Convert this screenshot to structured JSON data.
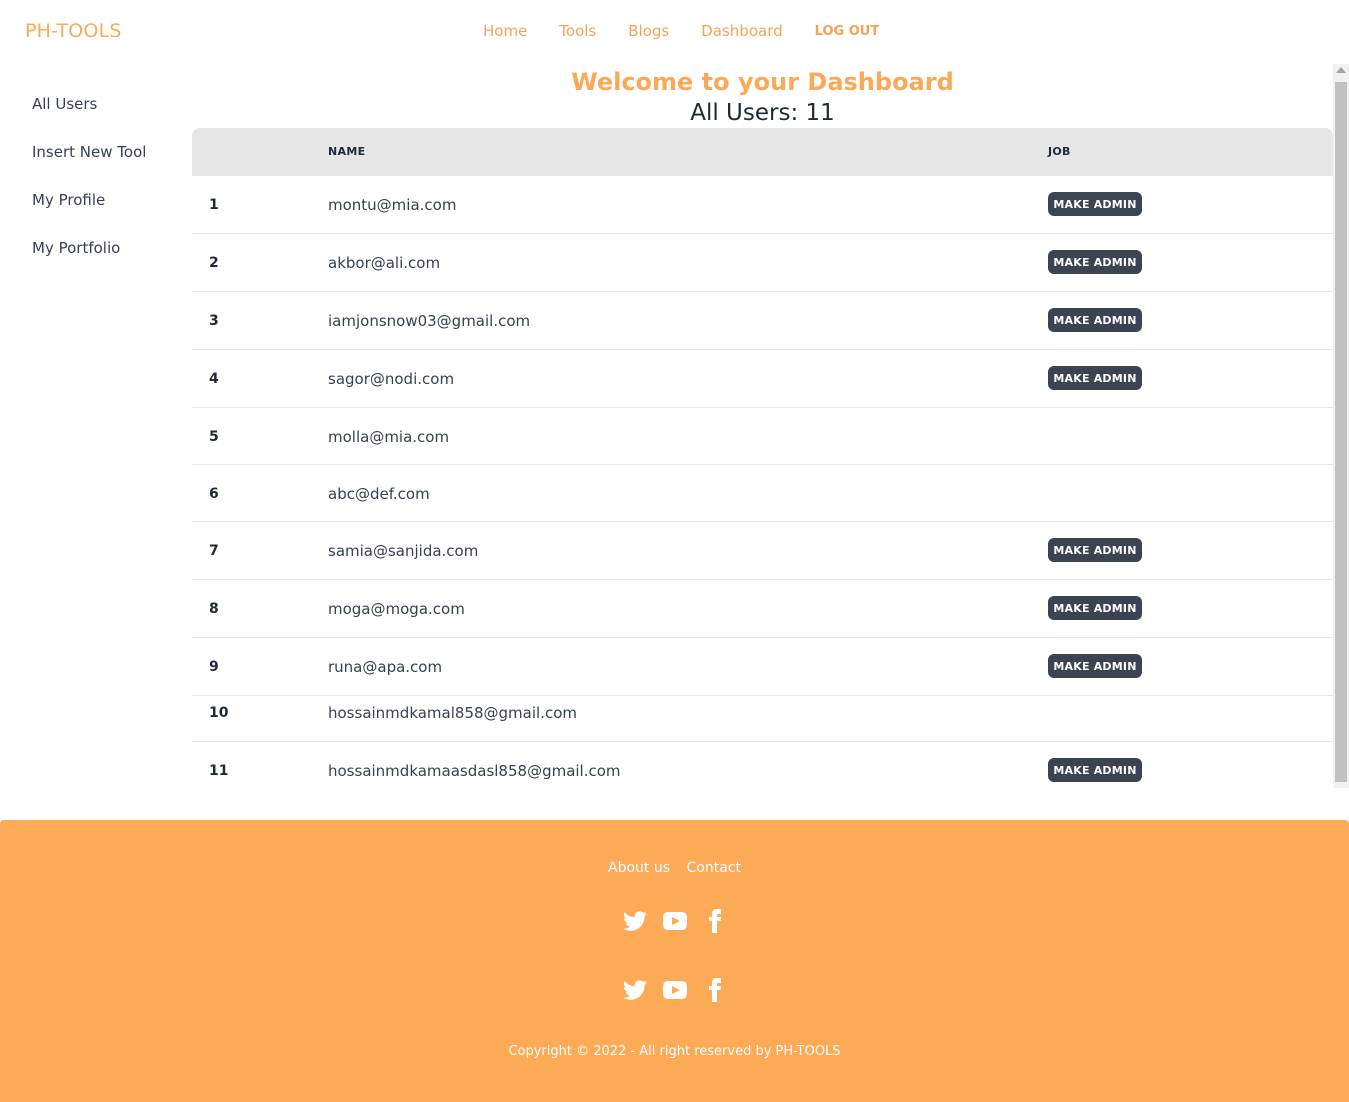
{
  "header": {
    "brand": "PH-TOOLS",
    "nav": [
      "Home",
      "Tools",
      "Blogs",
      "Dashboard"
    ],
    "logout": "LOG OUT"
  },
  "sidebar": {
    "items": [
      "All Users",
      "Insert New Tool",
      "My Profile",
      "My Portfolio"
    ]
  },
  "main": {
    "welcome": "Welcome to your Dashboard",
    "count": "All Users: 11",
    "columns": [
      "",
      "NAME",
      "JOB"
    ],
    "make_admin_label": "MAKE ADMIN",
    "rows": [
      {
        "index": "1",
        "email": "montu@mia.com",
        "admin_button": true
      },
      {
        "index": "2",
        "email": "akbor@ali.com",
        "admin_button": true
      },
      {
        "index": "3",
        "email": "iamjonsnow03@gmail.com",
        "admin_button": true
      },
      {
        "index": "4",
        "email": "sagor@nodi.com",
        "admin_button": true
      },
      {
        "index": "5",
        "email": "molla@mia.com",
        "admin_button": false
      },
      {
        "index": "6",
        "email": "abc@def.com",
        "admin_button": false
      },
      {
        "index": "7",
        "email": "samia@sanjida.com",
        "admin_button": true
      },
      {
        "index": "8",
        "email": "moga@moga.com",
        "admin_button": true
      },
      {
        "index": "9",
        "email": "runa@apa.com",
        "admin_button": true
      },
      {
        "index": "10",
        "email": "hossainmdkamal858@gmail.com",
        "admin_button": false
      },
      {
        "index": "11",
        "email": "hossainmdkamaasdasl858@gmail.com",
        "admin_button": true
      }
    ]
  },
  "footer": {
    "links": [
      "About us",
      "Contact"
    ],
    "social_icons": [
      "twitter-icon",
      "youtube-icon",
      "facebook-icon"
    ],
    "copyright": "Copyright © 2022 - All right reserved by PH-TOOLS"
  },
  "colors": {
    "accent": "#fba957",
    "footer_bg": "#fcaa56",
    "button_bg": "#3d4451",
    "table_header_bg": "#e6e6e6"
  }
}
